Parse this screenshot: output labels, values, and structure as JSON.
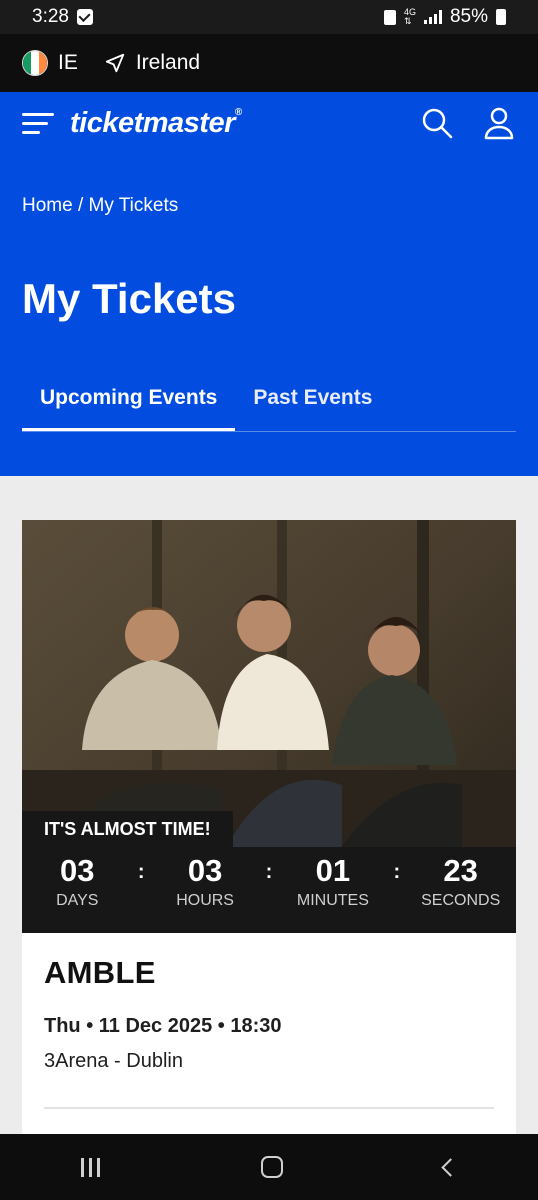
{
  "status_bar": {
    "time": "3:28",
    "network_label": "4G",
    "battery": "85%"
  },
  "locale": {
    "country_code": "IE",
    "location": "Ireland"
  },
  "header": {
    "logo_text": "ticketmaster",
    "brand_color": "#024ddf"
  },
  "breadcrumb": "Home / My Tickets",
  "page_title": "My Tickets",
  "tabs": [
    {
      "label": "Upcoming Events",
      "active": true
    },
    {
      "label": "Past Events",
      "active": false
    }
  ],
  "event": {
    "countdown_heading": "IT'S ALMOST TIME!",
    "countdown": [
      {
        "value": "03",
        "label": "DAYS"
      },
      {
        "value": "03",
        "label": "HOURS"
      },
      {
        "value": "01",
        "label": "MINUTES"
      },
      {
        "value": "23",
        "label": "SECONDS"
      }
    ],
    "name": "AMBLE",
    "date_time": "Thu • 11 Dec 2025 • 18:30",
    "venue": "3Arena - Dublin"
  }
}
